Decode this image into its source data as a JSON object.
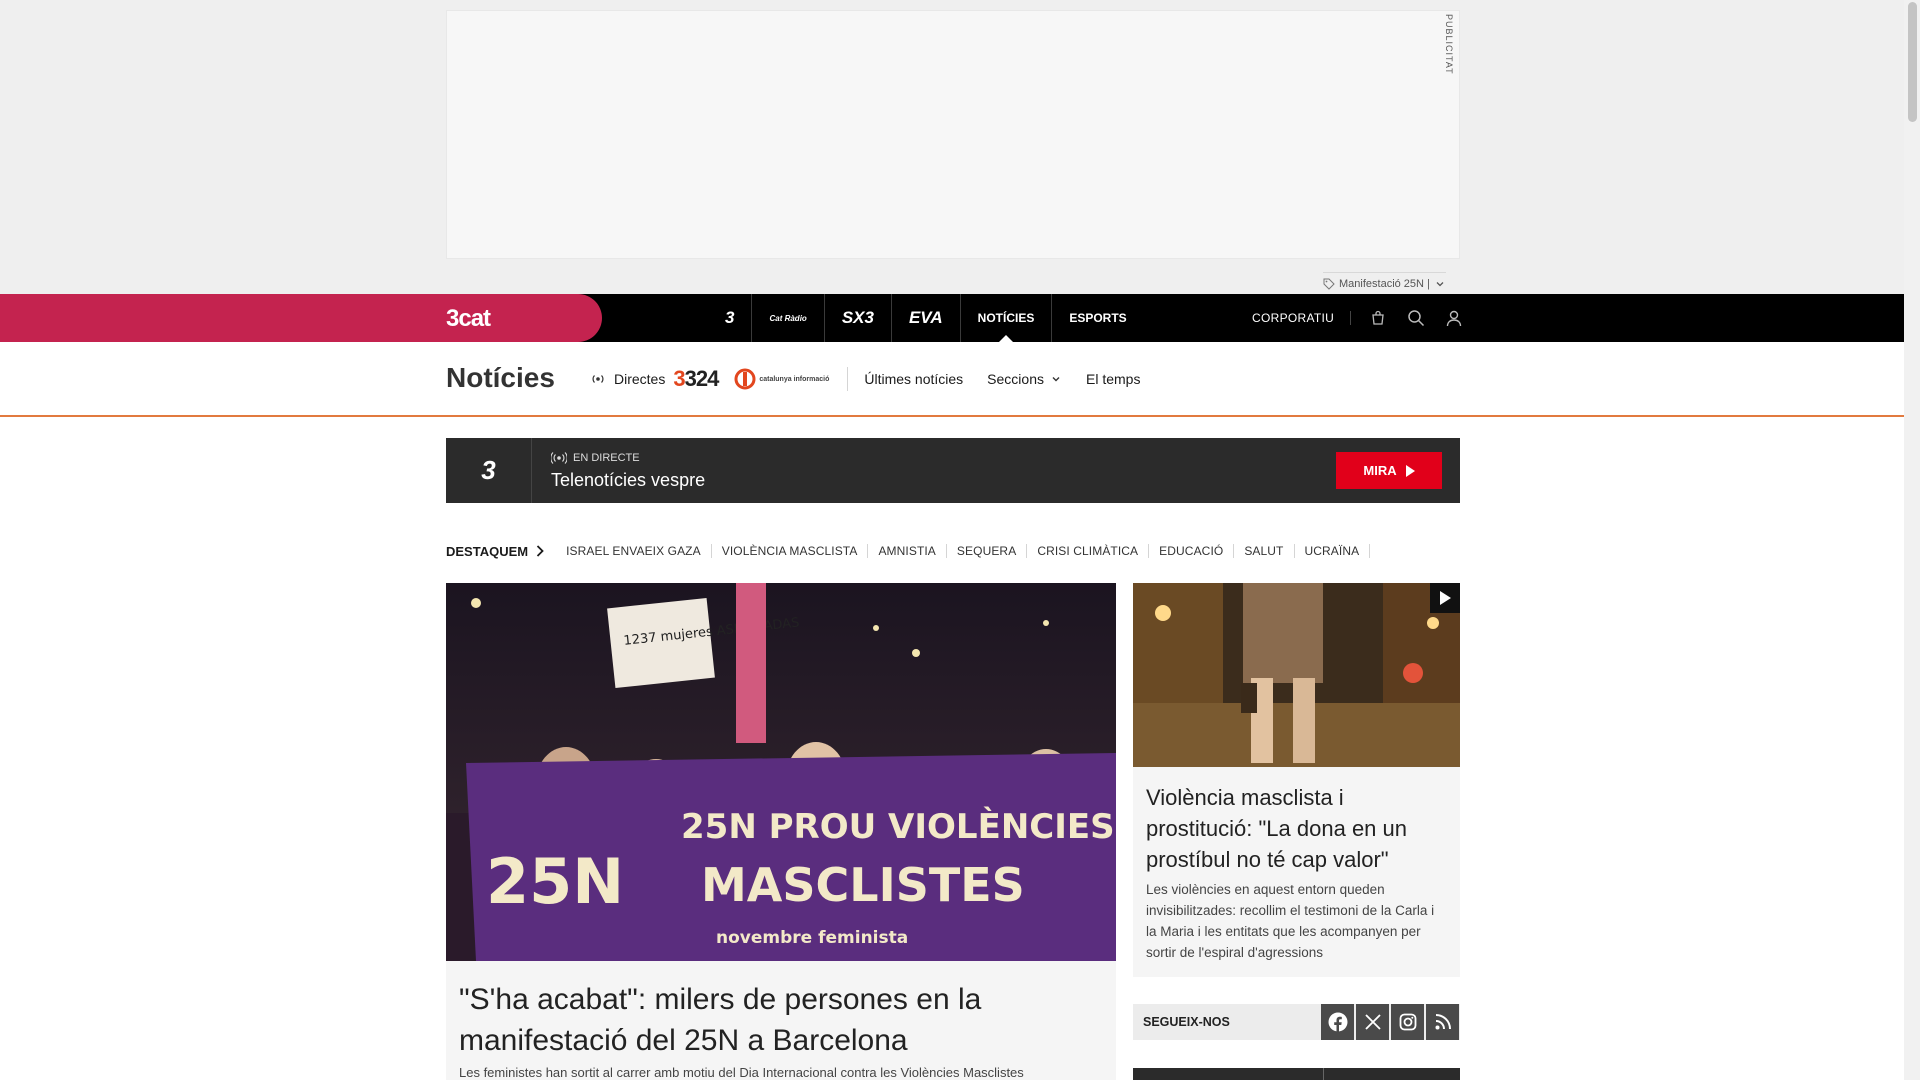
{
  "ad": {
    "label": "PUBLICITAT",
    "topic_tag": "Manifestació 25N |"
  },
  "global_nav": {
    "brand": "3cat",
    "channels": [
      {
        "label": "3",
        "icon": "tv3-logo"
      },
      {
        "label": "Cat Ràdio",
        "icon": "catradio-logo"
      },
      {
        "label": "SX3",
        "icon": "sx3-logo"
      },
      {
        "label": "EVA",
        "icon": "eva-logo"
      },
      {
        "label": "NOTÍCIES",
        "icon": ""
      },
      {
        "label": "ESPORTS",
        "icon": ""
      }
    ],
    "corporatiu": "CORPORATIU"
  },
  "section_nav": {
    "title": "Notícies",
    "directes": "Directes",
    "logo_324": "324",
    "logo_ci": "catalunya informació",
    "links": [
      "Últimes notícies",
      "Seccions",
      "El temps"
    ]
  },
  "live": {
    "channel_logo": "3",
    "tag": "EN DIRECTE",
    "title": "Telenotícies vespre",
    "button": "MIRA"
  },
  "destaquem": {
    "title": "DESTAQUEM",
    "items": [
      "ISRAEL ENVAEIX GAZA",
      "VIOLÈNCIA MASCLISTA",
      "AMNISTIA",
      "SEQUERA",
      "CRISI CLIMÀTICA",
      "EDUCACIÓ",
      "SALUT",
      "UCRAÏNA"
    ]
  },
  "main_article": {
    "image_banner_line1": "25N PROU VIOLÈNCIES",
    "image_banner_line2": "MASCLISTES",
    "image_banner_line3": "novembre feminista",
    "image_sign": "1237 mujeres ASESINADAS",
    "title": "\"S'ha acabat\": milers de persones en la manifestació del 25N a Barcelona",
    "subtitle": "Les feministes han sortit al carrer amb motiu del Dia Internacional contra les Violències Masclistes"
  },
  "side_article": {
    "title": "Violència masclista i prostitució: \"La dona en un prostíbul no té cap valor\"",
    "subtitle": "Les violències en aquest entorn queden invisibilitzades: recollim el testimoni de la Carla i la Maria i les entitats que les acompanyen per sortir de l'espiral d'agressions"
  },
  "follow": {
    "label": "SEGUEIX-NOS",
    "icons": [
      "facebook-icon",
      "x-icon",
      "instagram-icon",
      "rss-icon"
    ]
  },
  "colors": {
    "brand": "#c4234f",
    "accent": "#e27a3f",
    "live_button": "#e1001a"
  }
}
